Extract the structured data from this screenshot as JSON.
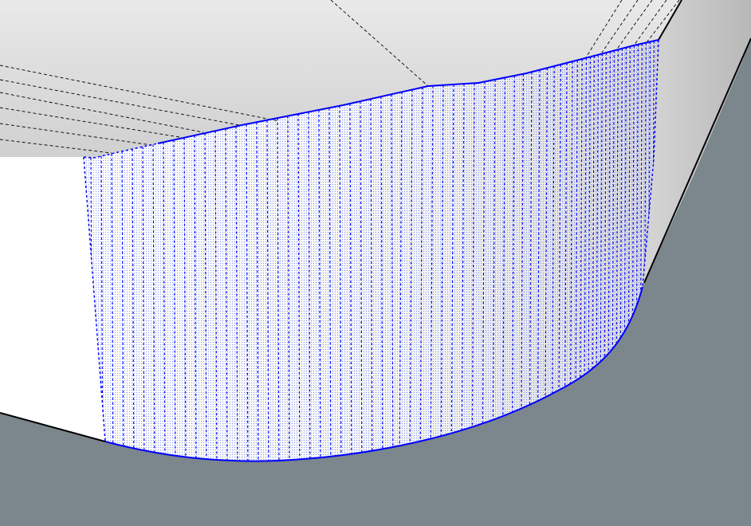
{
  "viewport": {
    "background_color": "#7b868d"
  },
  "model": {
    "top_face_color": "#d7d7d7",
    "front_face_color": "#ffffff",
    "right_side_face_color": "#c4c4c4",
    "edge_color": "#000000",
    "hidden_edge_style": "dashed",
    "selected_surface": {
      "selected": true,
      "highlight_color": "#0000ff",
      "texture": "stipple"
    }
  }
}
